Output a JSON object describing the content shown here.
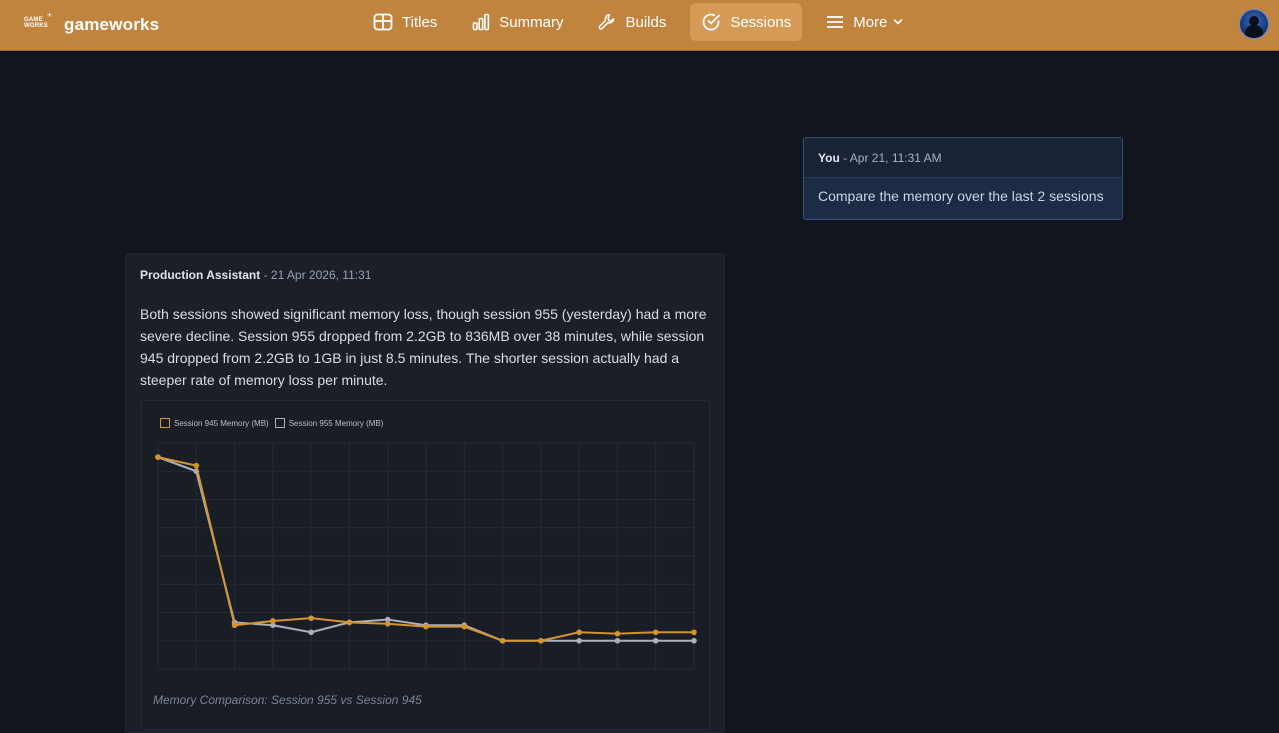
{
  "brand": {
    "logo_text": "GAME WORKS",
    "name": "gameworks"
  },
  "nav": {
    "items": [
      {
        "label": "Titles",
        "icon": "table-icon",
        "active": false
      },
      {
        "label": "Summary",
        "icon": "bar-chart-icon",
        "active": false
      },
      {
        "label": "Builds",
        "icon": "wrench-icon",
        "active": false
      },
      {
        "label": "Sessions",
        "icon": "check-circle-icon",
        "active": true
      },
      {
        "label": "More",
        "icon": "hamburger-menu-icon",
        "active": false
      }
    ]
  },
  "user_message": {
    "author": "You",
    "timestamp": "- Apr 21, 11:31 AM",
    "text": "Compare the memory over the last 2 sessions"
  },
  "assistant_message": {
    "author": "Production Assistant",
    "timestamp": "- 21 Apr 2026, 11:31",
    "text": "Both sessions showed significant memory loss, though session 955 (yesterday) had a more severe decline. Session 955 dropped from 2.2GB to 836MB over 38 minutes, while session 945 dropped from 2.2GB to 1GB in just 8.5 minutes. The shorter session actually had a steeper rate of memory loss per minute."
  },
  "colors": {
    "accent": "#c0843f",
    "series_945": "#d4952f",
    "series_955": "#aab0bc"
  },
  "chart_data": {
    "type": "line",
    "title": "Memory Comparison: Session 955 vs Session 945",
    "xlabel": "",
    "ylabel": "",
    "grid": true,
    "legend_position": "top-left",
    "x": [
      1,
      2,
      3,
      4,
      5,
      6,
      7,
      8,
      9,
      10,
      11,
      12,
      13,
      14,
      15
    ],
    "ylim": [
      700,
      2300
    ],
    "series": [
      {
        "name": "Session 945 Memory (MB)",
        "color": "#d4952f",
        "values": [
          2200,
          2140,
          1010,
          1040,
          1060,
          1030,
          1020,
          1000,
          1000,
          900,
          900,
          960,
          950,
          960,
          960
        ]
      },
      {
        "name": "Session 955 Memory (MB)",
        "color": "#aab0bc",
        "values": [
          2200,
          2100,
          1030,
          1010,
          960,
          1030,
          1050,
          1010,
          1010,
          900,
          900,
          900,
          900,
          900,
          900
        ]
      }
    ]
  }
}
